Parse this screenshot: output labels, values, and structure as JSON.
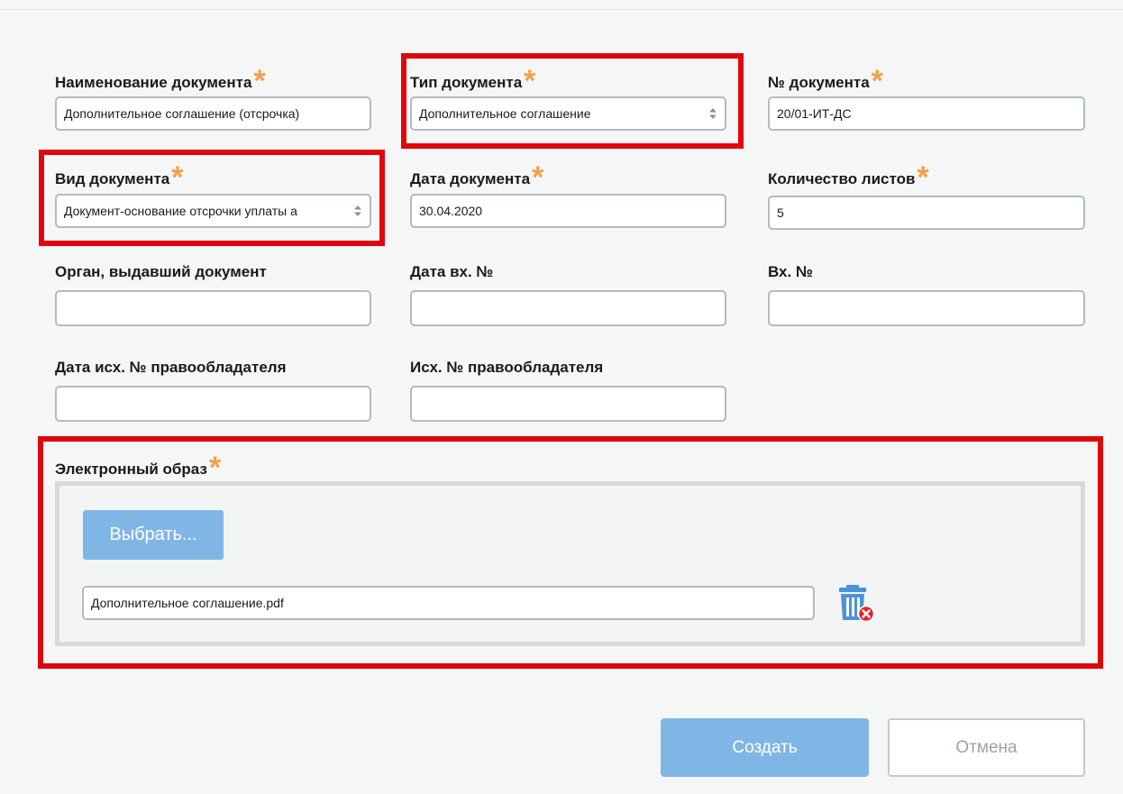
{
  "form": {
    "doc_name": {
      "label": "Наименование документа",
      "value": "Дополнительное соглашение (отсрочка)",
      "required": true
    },
    "doc_type": {
      "label": "Тип документа",
      "value": "Дополнительное соглашение",
      "required": true
    },
    "doc_number": {
      "label": "№ документа",
      "value": "20/01-ИТ-ДС",
      "required": true
    },
    "doc_kind": {
      "label": "Вид документа",
      "value": "Документ-основание отсрочки уплаты а",
      "required": true
    },
    "doc_date": {
      "label": "Дата документа",
      "value": "30.04.2020",
      "required": true
    },
    "sheet_count": {
      "label": "Количество листов",
      "value": "5",
      "required": true
    },
    "issuing_authority": {
      "label": "Орган, выдавший документ",
      "value": "",
      "required": false
    },
    "incoming_date": {
      "label": "Дата вх. №",
      "value": "",
      "required": false
    },
    "incoming_number": {
      "label": "Вх. №",
      "value": "",
      "required": false
    },
    "outgoing_date": {
      "label": "Дата исх. № правообладателя",
      "value": "",
      "required": false
    },
    "outgoing_number": {
      "label": "Исх. № правообладателя",
      "value": "",
      "required": false
    },
    "required_mark": "*"
  },
  "upload": {
    "label": "Электронный образ",
    "choose_button": "Выбрать...",
    "file_name": "Дополнительное соглашение.pdf",
    "delete_icon": "trash-delete-icon"
  },
  "actions": {
    "create": "Создать",
    "cancel": "Отмена"
  },
  "colors": {
    "highlight_frame": "#e0060d",
    "required_star": "#f0a04b",
    "primary_button": "#7fb6e6"
  }
}
